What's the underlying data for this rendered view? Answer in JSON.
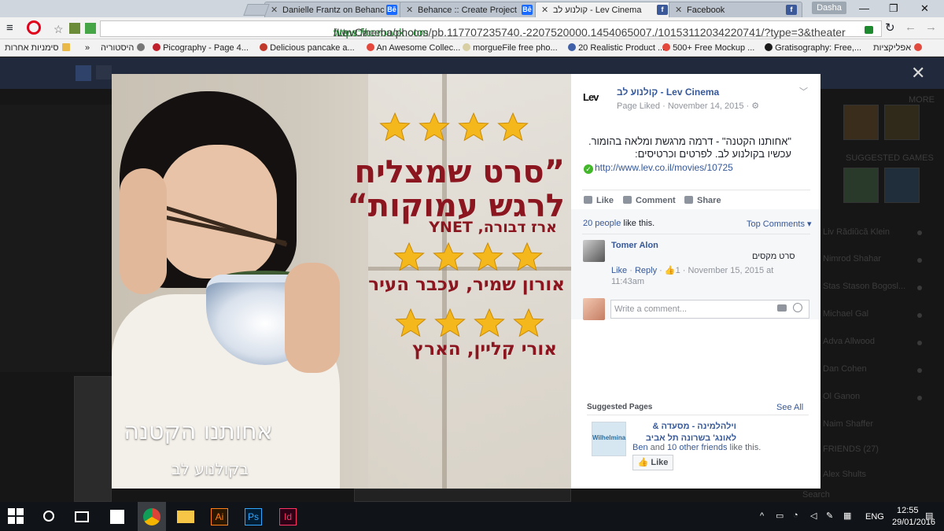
{
  "browser": {
    "tabs": [
      {
        "label": "Danielle Frantz on Behanc",
        "icon": "behance-icon",
        "active": false
      },
      {
        "label": "Behance :: Create Project",
        "icon": "behance-icon",
        "active": false
      },
      {
        "label": "קולנוע לב - Lev Cinema",
        "icon": "facebook-icon",
        "active": true
      },
      {
        "label": "Facebook",
        "icon": "facebook-icon",
        "active": false
      }
    ],
    "user": "Dasha",
    "url_scheme": "https://",
    "url_host": "www.facebook.com",
    "url_path": "/LevCinema/photos/pb.117707235740.-2207520000.1454065007./10153112034220741/?type=3&theater",
    "bookmarks": [
      {
        "label": "אפליקציות",
        "color": "#e04a3f"
      },
      {
        "label": "Gratisography: Free,...",
        "color": "#1a1a1a"
      },
      {
        "label": "500+ Free Mockup ...",
        "color": "#e4473b"
      },
      {
        "label": "20 Realistic Product ...",
        "color": "#3f5fa8"
      },
      {
        "label": "morgueFile free pho...",
        "color": "#d8d0a4"
      },
      {
        "label": "An Awesome Collec...",
        "color": "#e4473b"
      },
      {
        "label": "Delicious pancake a...",
        "color": "#c0392b"
      },
      {
        "label": "Picography - Page 4...",
        "color": "#c0202b"
      },
      {
        "label": "היסטוריה",
        "color": "#777777"
      },
      {
        "label": "»",
        "color": ""
      },
      {
        "label": "סימניות אחרות",
        "color": "#e9b949"
      }
    ]
  },
  "photo": {
    "headline_line1": "”סרט שמצליח",
    "headline_line2": "לרגש עמוקות“",
    "credit1": "ארז דבורה, YNET",
    "credit2": "אורון שמיר, עכבר העיר",
    "credit3": "אורי קליין, הארץ",
    "film_title": "אחותנו הקטנה",
    "cinema_label": "בקולנוע לב",
    "star_color": "#f4b81c",
    "rating_rows": [
      4,
      4,
      4
    ]
  },
  "post": {
    "page_name": "קולנוע לב - Lev Cinema",
    "meta": "Page Liked · November 14, 2015 · ⚙",
    "text": "\"אחותנו הקטנה\" - דרמה מרגשת ומלאה בהומור. עכשיו בקולנוע לב. לפרטים וכרטיסים:",
    "link": "http://www.lev.co.il/movies/10725",
    "like_label": "Like",
    "comment_label": "Comment",
    "share_label": "Share",
    "likes_count": "20 people",
    "likes_suffix": " like this.",
    "top_comments": "Top Comments ▾",
    "comment": {
      "author": "Tomer Alon",
      "text": "סרט מקסים",
      "like": "Like",
      "reply": "Reply",
      "reactions": "1",
      "date": "November 15, 2015 at 11:43am"
    },
    "write_placeholder": "Write a comment..."
  },
  "suggested": {
    "title": "Suggested Pages",
    "see_all": "See All",
    "page_name": "וילהלמינה - מסעדה & לאונג' בשרונה תל אביב",
    "thumb_text": "Wilhelmina",
    "friend": "Ben",
    "friends_mid": " and ",
    "friends_count": "10 other friends",
    "friends_suffix": " like this.",
    "like_button": "Like"
  },
  "background": {
    "sidebar_names": [
      "Liv Rădiŭcă Klein",
      "Nimrod Shahar",
      "Stas Stason Bogosl...",
      "Michael Gal",
      "Adva Allwood",
      "Dan Cohen",
      "Ol Ganon",
      "Naim Shaffer",
      "FRIENDS (27)",
      "Alex Shults"
    ],
    "search_label": "Search",
    "more_label": "MORE",
    "games_label": "SUGGESTED GAMES"
  },
  "taskbar": {
    "language": "ENG",
    "time": "12:55",
    "date": "29/01/2016"
  }
}
